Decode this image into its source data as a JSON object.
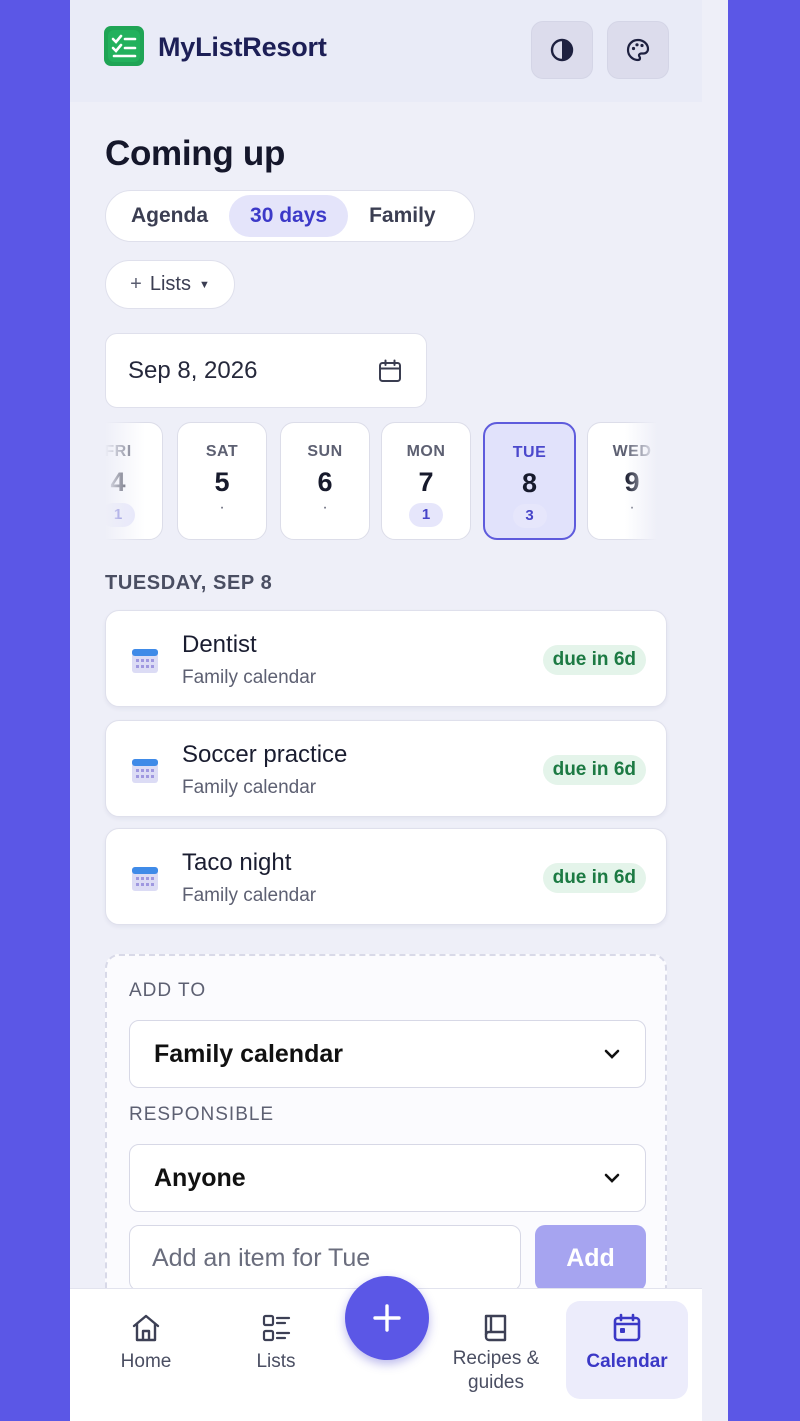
{
  "header": {
    "app_title": "MyListResort",
    "theme_icon": "contrast-icon",
    "palette_icon": "palette-icon"
  },
  "page": {
    "title": "Coming up"
  },
  "view_tabs": [
    {
      "label": "Agenda",
      "active": false
    },
    {
      "label": "30 days",
      "active": true
    },
    {
      "label": "Family",
      "active": false
    }
  ],
  "lists_filter": {
    "plus": "+",
    "label": "Lists",
    "caret": "▼"
  },
  "date_picker": {
    "value": "Sep 8, 2026"
  },
  "days": [
    {
      "dow": "FRI",
      "num": "4",
      "count": "1",
      "active": false
    },
    {
      "dow": "SAT",
      "num": "5",
      "count": "·",
      "active": false
    },
    {
      "dow": "SUN",
      "num": "6",
      "count": "·",
      "active": false
    },
    {
      "dow": "MON",
      "num": "7",
      "count": "1",
      "active": false
    },
    {
      "dow": "TUE",
      "num": "8",
      "count": "3",
      "active": true
    },
    {
      "dow": "WED",
      "num": "9",
      "count": "·",
      "active": false
    }
  ],
  "section": {
    "heading": "TUESDAY, SEP 8"
  },
  "events": [
    {
      "title": "Dentist",
      "list": "Family calendar",
      "badge": "due in 6d"
    },
    {
      "title": "Soccer practice",
      "list": "Family calendar",
      "badge": "due in 6d"
    },
    {
      "title": "Taco night",
      "list": "Family calendar",
      "badge": "due in 6d"
    }
  ],
  "add_form": {
    "add_to_label": "ADD TO",
    "add_to_value": "Family calendar",
    "responsible_label": "RESPONSIBLE",
    "responsible_value": "Anyone",
    "item_placeholder": "Add an item for Tue",
    "add_button": "Add"
  },
  "nav": [
    {
      "label": "Home",
      "icon": "home-icon",
      "active": false
    },
    {
      "label": "Lists",
      "icon": "list-icon",
      "active": false
    },
    {
      "label": "Recipes &\nguides",
      "icon": "book-icon",
      "active": false
    },
    {
      "label": "Calendar",
      "icon": "calendar-icon",
      "active": true
    }
  ],
  "colors": {
    "accent": "#5b57e6",
    "brand_green": "#1fa455",
    "badge_green": "#1c7a43"
  }
}
